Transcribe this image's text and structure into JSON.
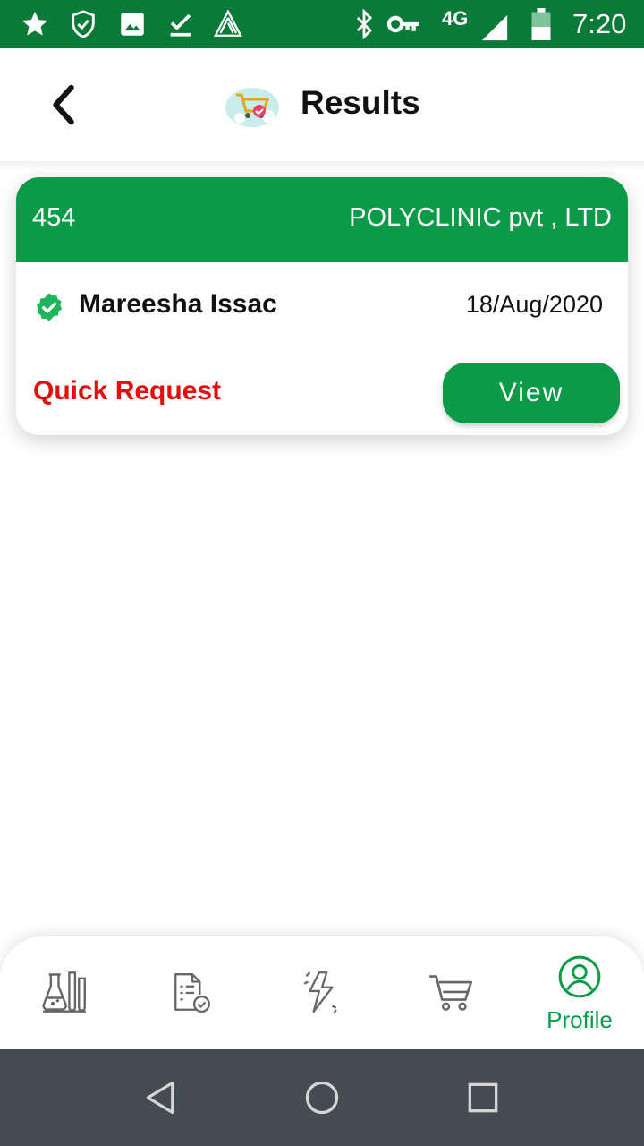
{
  "status_bar": {
    "network": "4G",
    "time": "7:20",
    "icons": [
      "star-icon",
      "shield-check-icon",
      "image-icon",
      "download-done-icon",
      "app-triangle-icon",
      "bluetooth-icon",
      "key-icon",
      "signal-icon",
      "battery-icon"
    ]
  },
  "header": {
    "title": "Results",
    "back_icon": "chevron-left-icon",
    "logo_icon": "cart-cloud-logo"
  },
  "result_card": {
    "id": "454",
    "organization": "POLYCLINIC pvt , LTD",
    "patient_name": "Mareesha Issac",
    "date": "18/Aug/2020",
    "request_type": "Quick Request",
    "view_label": "View",
    "verified_icon": "verified-check-icon"
  },
  "bottom_nav": {
    "items": [
      {
        "icon": "lab-flask-icon",
        "label": ""
      },
      {
        "icon": "report-check-icon",
        "label": ""
      },
      {
        "icon": "flash-icon",
        "label": ""
      },
      {
        "icon": "cart-icon",
        "label": ""
      },
      {
        "icon": "profile-icon",
        "label": "Profile",
        "active": true
      }
    ]
  },
  "system_nav": {
    "icons": [
      "back-triangle-icon",
      "home-circle-icon",
      "recents-square-icon"
    ]
  },
  "colors": {
    "status_bar": "#0a7a38",
    "primary": "#0a9a48",
    "alert": "#e30f0f",
    "system_nav": "#454b52"
  }
}
